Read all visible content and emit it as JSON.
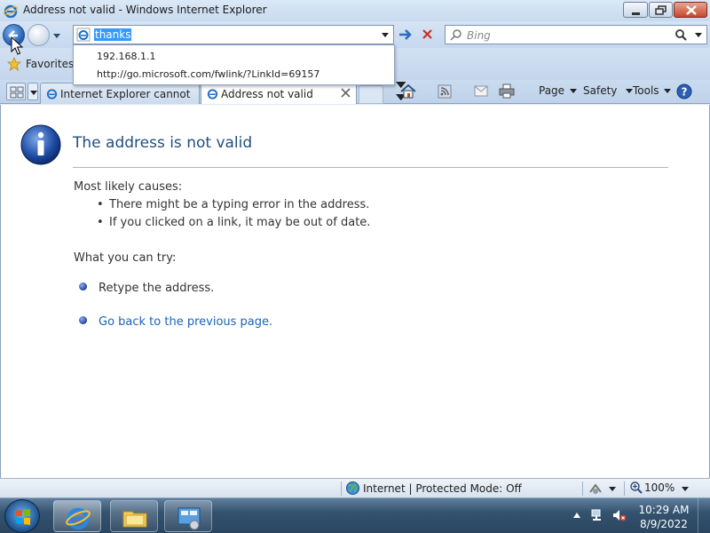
{
  "window": {
    "title": "Address not valid - Windows Internet Explorer"
  },
  "address_bar": {
    "value": "thanks",
    "suggestions": [
      "192.168.1.1",
      "http://go.microsoft.com/fwlink/?LinkId=69157"
    ]
  },
  "search": {
    "placeholder": "Bing"
  },
  "favorites": {
    "label": "Favorites"
  },
  "tabs": [
    {
      "label": "Internet Explorer cannot di...",
      "active": false
    },
    {
      "label": "Address not valid",
      "active": true
    }
  ],
  "command_bar": {
    "page": "Page",
    "safety": "Safety",
    "tools": "Tools"
  },
  "content": {
    "heading": "The address is not valid",
    "causes_heading": "Most likely causes:",
    "causes": [
      "There might be a typing error in the address.",
      "If you clicked on a link, it may be out of date."
    ],
    "try_heading": "What you can try:",
    "try_items": [
      "Retype the address.",
      "Go back to the previous page."
    ]
  },
  "status": {
    "zone": "Internet | Protected Mode: Off",
    "zoom": "100%"
  },
  "taskbar": {
    "time": "10:29 AM",
    "date": "8/9/2022"
  },
  "colors": {
    "heading": "#1f4f81",
    "link": "#1a63b8",
    "selection": "#3399ff"
  }
}
